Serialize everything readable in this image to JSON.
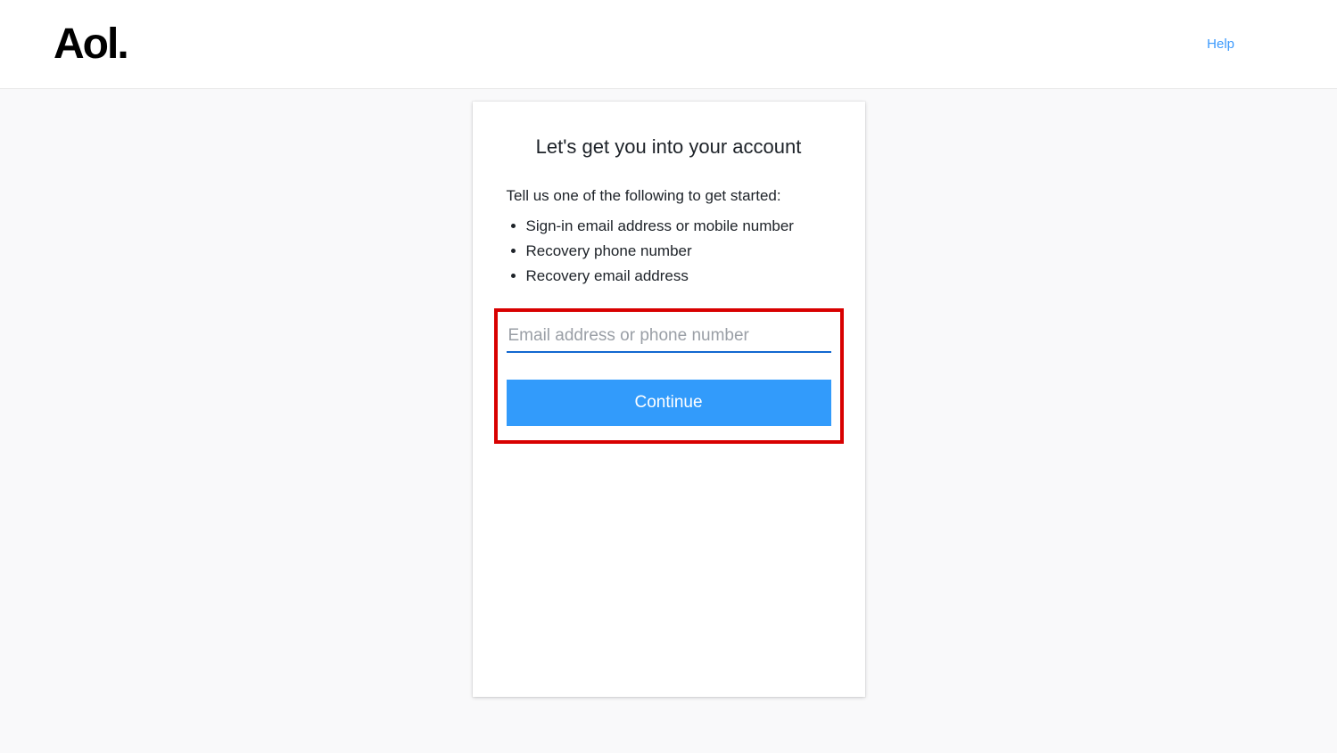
{
  "header": {
    "logo_text": "Aol.",
    "help_label": "Help"
  },
  "card": {
    "title": "Let's get you into your account",
    "subtitle": "Tell us one of the following to get started:",
    "bullets": [
      "Sign-in email address or mobile number",
      "Recovery phone number",
      "Recovery email address"
    ],
    "input_placeholder": "Email address or phone number",
    "input_value": "",
    "continue_label": "Continue"
  }
}
